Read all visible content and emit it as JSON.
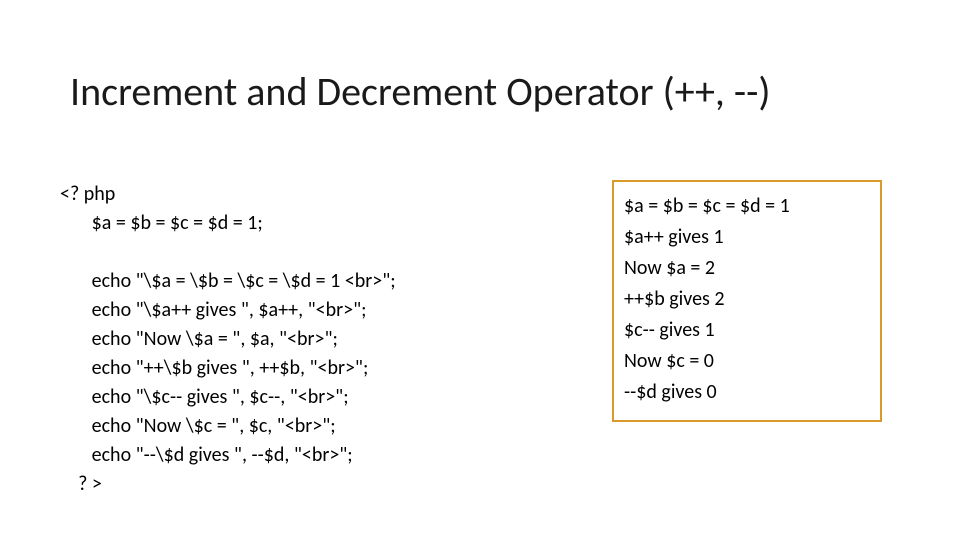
{
  "title": "Increment and Decrement Operator (++, --)",
  "code": {
    "l0": "<? php",
    "l1": "       $a = $b = $c = $d = 1;",
    "l2": "",
    "l3": "       echo \"\\$a = \\$b = \\$c = \\$d = 1 <br>\";",
    "l4": "       echo \"\\$a++ gives \", $a++, \"<br>\";",
    "l5": "       echo \"Now \\$a = \", $a, \"<br>\";",
    "l6": "       echo \"++\\$b gives \", ++$b, \"<br>\";",
    "l7": "       echo \"\\$c-- gives \", $c--, \"<br>\";",
    "l8": "       echo \"Now \\$c = \", $c, \"<br>\";",
    "l9": "       echo \"--\\$d gives \", --$d, \"<br>\";",
    "l10": "    ? >"
  },
  "output": {
    "o0": "$a = $b = $c = $d = 1",
    "o1": "$a++ gives 1",
    "o2": "Now $a = 2",
    "o3": "++$b gives 2",
    "o4": "$c-- gives 1",
    "o5": "Now $c = 0",
    "o6": "--$d gives 0"
  },
  "colors": {
    "box_border": "#d99a2b"
  }
}
